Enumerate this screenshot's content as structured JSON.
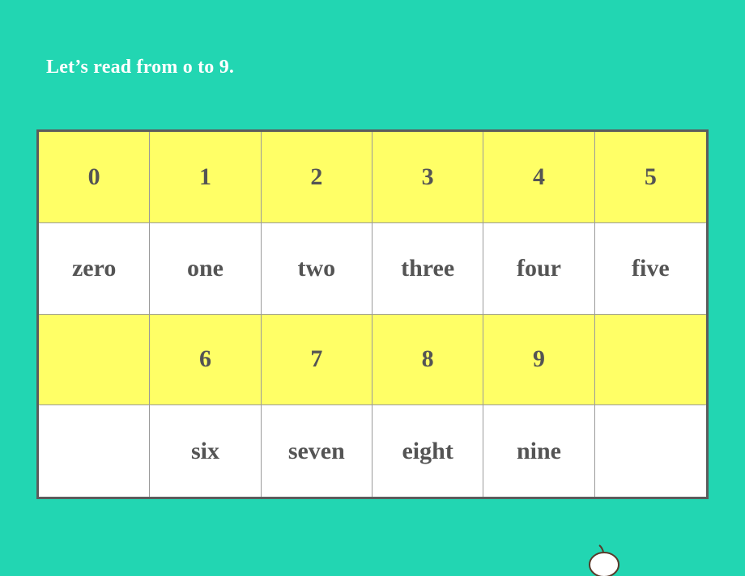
{
  "title": "Let’s read from o to 9.",
  "table": {
    "rows": [
      {
        "style": "yellow",
        "cells": [
          "0",
          "1",
          "2",
          "3",
          "4",
          "5"
        ]
      },
      {
        "style": "white",
        "cells": [
          "zero",
          "one",
          "two",
          "three",
          "four",
          "five"
        ]
      },
      {
        "style": "yellow",
        "cells": [
          "",
          "6",
          "7",
          "8",
          "9",
          ""
        ]
      },
      {
        "style": "white",
        "cells": [
          "",
          "six",
          "seven",
          "eight",
          "nine",
          ""
        ]
      }
    ]
  },
  "colors": {
    "background": "#22d6b2",
    "row_highlight": "#ffff66",
    "text": "#545454"
  },
  "mascot": {
    "icon": "cartoon-head-icon"
  }
}
